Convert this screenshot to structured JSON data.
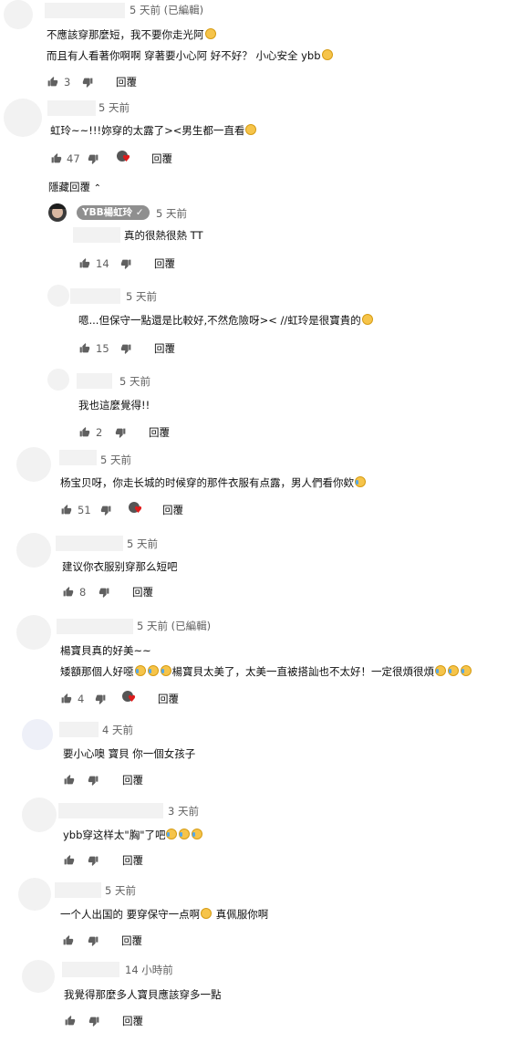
{
  "comments": [
    {
      "time": "5 天前 (已編輯)",
      "lines": [
        "不應該穿那麼短，我不要你走光阿",
        "而且有人看著你啊啊 穿著要小心阿 好不好？ 小心安全 ybb"
      ],
      "likes": "3",
      "reply": "回覆"
    },
    {
      "time": "5 天前",
      "lines": [
        "虹玲~~!!!妳穿的太露了><男生都一直看"
      ],
      "likes": "47",
      "reply": "回覆"
    }
  ],
  "hide_replies": "隱藏回覆",
  "replies": [
    {
      "author": "YBB楊虹玲",
      "time": "5 天前",
      "text": "真的很熱很熱 TT",
      "likes": "14",
      "reply": "回覆"
    },
    {
      "time": "5 天前",
      "text": "嗯...但保守一點還是比較好,不然危險呀><  //虹玲是很寶貴的",
      "likes": "15",
      "reply": "回覆"
    },
    {
      "time": "5 天前",
      "text": "我也這麼覺得!!",
      "likes": "2",
      "reply": "回覆"
    }
  ],
  "more_comments": [
    {
      "time": "5 天前",
      "text": "杨宝贝呀，你走长城的时候穿的那件衣服有点露，男人們看你欸",
      "likes": "51",
      "reply": "回覆"
    },
    {
      "time": "5 天前",
      "text": "建议你衣服别穿那么短吧",
      "likes": "8",
      "reply": "回覆"
    },
    {
      "time": "5 天前 (已編輯)",
      "lines": [
        "楊寶貝真的好美~~",
        "矮額那個人好噁"
      ],
      "line2_mid": "楊寶貝太美了，太美一直被搭訕也不太好！一定很煩很煩",
      "likes": "4",
      "reply": "回覆"
    },
    {
      "time": "4 天前",
      "text": "要小心噢 寶貝 你一個女孩子",
      "reply": "回覆"
    },
    {
      "time": "3 天前",
      "text": "ybb穿这样太\"胸\"了吧",
      "reply": "回覆"
    },
    {
      "time": "5 天前",
      "text": "一个人出国的 要穿保守一点啊",
      "text_after": " 真佩服你啊",
      "reply": "回覆"
    },
    {
      "time": "14 小時前",
      "text": "我覺得那麼多人寶貝應該穿多一點",
      "reply": "回覆"
    }
  ],
  "icons": {
    "like": "thumb-up-icon",
    "dislike": "thumb-down-icon",
    "hide": "chevron-up-icon",
    "verified": "check-circle-icon",
    "creator_heart": "creator-heart-icon"
  },
  "colors": {
    "text": "#0f0f0f",
    "secondary": "#606060",
    "placeholder": "#f2f2f2",
    "heart": "#e01b1b",
    "chip": "#8f8f8f"
  }
}
